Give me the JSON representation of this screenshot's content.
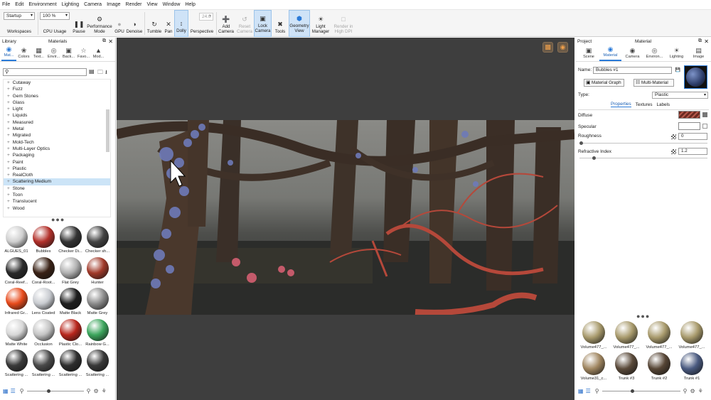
{
  "menu": [
    "File",
    "Edit",
    "Environment",
    "Lighting",
    "Camera",
    "Image",
    "Render",
    "View",
    "Window",
    "Help"
  ],
  "toolbar": {
    "workspace_value": "Startup",
    "workspaces_label": "Workspaces",
    "zoom_value": "100 %",
    "cpu_usage_label": "CPU Usage",
    "pause_label": "Pause",
    "performance_mode_label": "Performance Mode",
    "gpu_label": "GPU",
    "denoise_label": "Denoise",
    "tumble_label": "Tumble",
    "pan_label": "Pan",
    "dolly_label": "Dolly",
    "focal_value": "24.0",
    "perspective_label": "Perspective",
    "add_camera_label": "Add Camera",
    "reset_camera_label": "Reset Camera",
    "lock_camera_label": "Lock Camera",
    "tools_label": "Tools",
    "geometry_view_label": "Geometry View",
    "light_manager_label": "Light Manager",
    "render_high_dpi_label": "Render in High DPI"
  },
  "library": {
    "title": "Library",
    "panel_title": "Materials",
    "tabs": [
      {
        "label": "Mat...",
        "icon": "material-icon"
      },
      {
        "label": "Colors",
        "icon": "colors-icon"
      },
      {
        "label": "Text...",
        "icon": "texture-icon"
      },
      {
        "label": "Envir...",
        "icon": "environment-icon"
      },
      {
        "label": "Back...",
        "icon": "backplate-icon"
      },
      {
        "label": "Favo...",
        "icon": "star-icon"
      },
      {
        "label": "Mod...",
        "icon": "models-icon"
      }
    ],
    "tree": [
      "Cutaway",
      "Fuzz",
      "Gem Stones",
      "Glass",
      "Light",
      "Liquids",
      "Measured",
      "Metal",
      "Migrated",
      "Mold-Tech",
      "Multi-Layer Optics",
      "Packaging",
      "Paint",
      "Plastic",
      "RealCloth",
      "Scattering Medium",
      "Stone",
      "Toon",
      "Translucent",
      "Wood"
    ],
    "selected_tree_item": "Scattering Medium",
    "thumbnails": [
      {
        "label": "ALGUES_01",
        "color": "#cfcfcf"
      },
      {
        "label": "Bubbles",
        "color": "#b2302a"
      },
      {
        "label": "Checker Di...",
        "color": "#333333"
      },
      {
        "label": "Checker sh...",
        "color": "#444444"
      },
      {
        "label": "Coral-Reef...",
        "color": "#2a2a2a"
      },
      {
        "label": "Coral-Root...",
        "color": "#3a2216"
      },
      {
        "label": "Flat Grey",
        "color": "#b0b0b0"
      },
      {
        "label": "Hunter",
        "color": "#a13a2a"
      },
      {
        "label": "Infrared Gr...",
        "color": "#e84b1c"
      },
      {
        "label": "Lens Coated",
        "color": "#c9ccd1"
      },
      {
        "label": "Matte Black",
        "color": "#1e1e1e"
      },
      {
        "label": "Matte Grey",
        "color": "#8c8c8c"
      },
      {
        "label": "Matte White",
        "color": "#d7d7d7"
      },
      {
        "label": "Occlusion",
        "color": "#c4c4c4"
      },
      {
        "label": "Plastic Clo...",
        "color": "#b8261c"
      },
      {
        "label": "Rainbow G...",
        "color": "#3ba55c"
      },
      {
        "label": "Scattering ...",
        "color": "#3a3a3a"
      },
      {
        "label": "Scattering ...",
        "color": "#4a4a4a"
      },
      {
        "label": "Scattering ...",
        "color": "#2e2e2e"
      },
      {
        "label": "Scattering ...",
        "color": "#383838"
      }
    ]
  },
  "project": {
    "title": "Project",
    "panel_title": "Material",
    "tabs": [
      {
        "label": "Scene",
        "icon": "scene-icon"
      },
      {
        "label": "Material",
        "icon": "material-icon"
      },
      {
        "label": "Camera",
        "icon": "camera-icon"
      },
      {
        "label": "Environ...",
        "icon": "environment-icon"
      },
      {
        "label": "Lighting",
        "icon": "lighting-icon"
      },
      {
        "label": "Image",
        "icon": "image-icon"
      }
    ],
    "name_label": "Name:",
    "name_value": "Bubbles #1",
    "material_graph_label": "Material Graph",
    "multi_material_label": "Multi-Material",
    "type_label": "Type:",
    "type_value": "Plastic",
    "sub_tabs": [
      "Properties",
      "Textures",
      "Labels"
    ],
    "diffuse_label": "Diffuse",
    "specular_label": "Specular",
    "roughness_label": "Roughness",
    "roughness_value": "0",
    "refractive_index_label": "Refractive Index",
    "refractive_index_value": "1.2",
    "thumbnails": [
      {
        "label": "Volume477_...",
        "color": "#a89a6c"
      },
      {
        "label": "Volume477_...",
        "color": "#a89a6c"
      },
      {
        "label": "Volume477_...",
        "color": "#a89a6c"
      },
      {
        "label": "Volume477_...",
        "color": "#a89a6c"
      },
      {
        "label": "Volume31_c...",
        "color": "#a08660"
      },
      {
        "label": "Trunk #3",
        "color": "#5a4a3a"
      },
      {
        "label": "Trunk #2",
        "color": "#564535"
      },
      {
        "label": "Trunk #1",
        "color": "#4a5a80"
      }
    ]
  },
  "colors": {
    "accent": "#2a7ad8",
    "selection": "#cce4f7",
    "viewport_bg": "#3e3e3e"
  }
}
